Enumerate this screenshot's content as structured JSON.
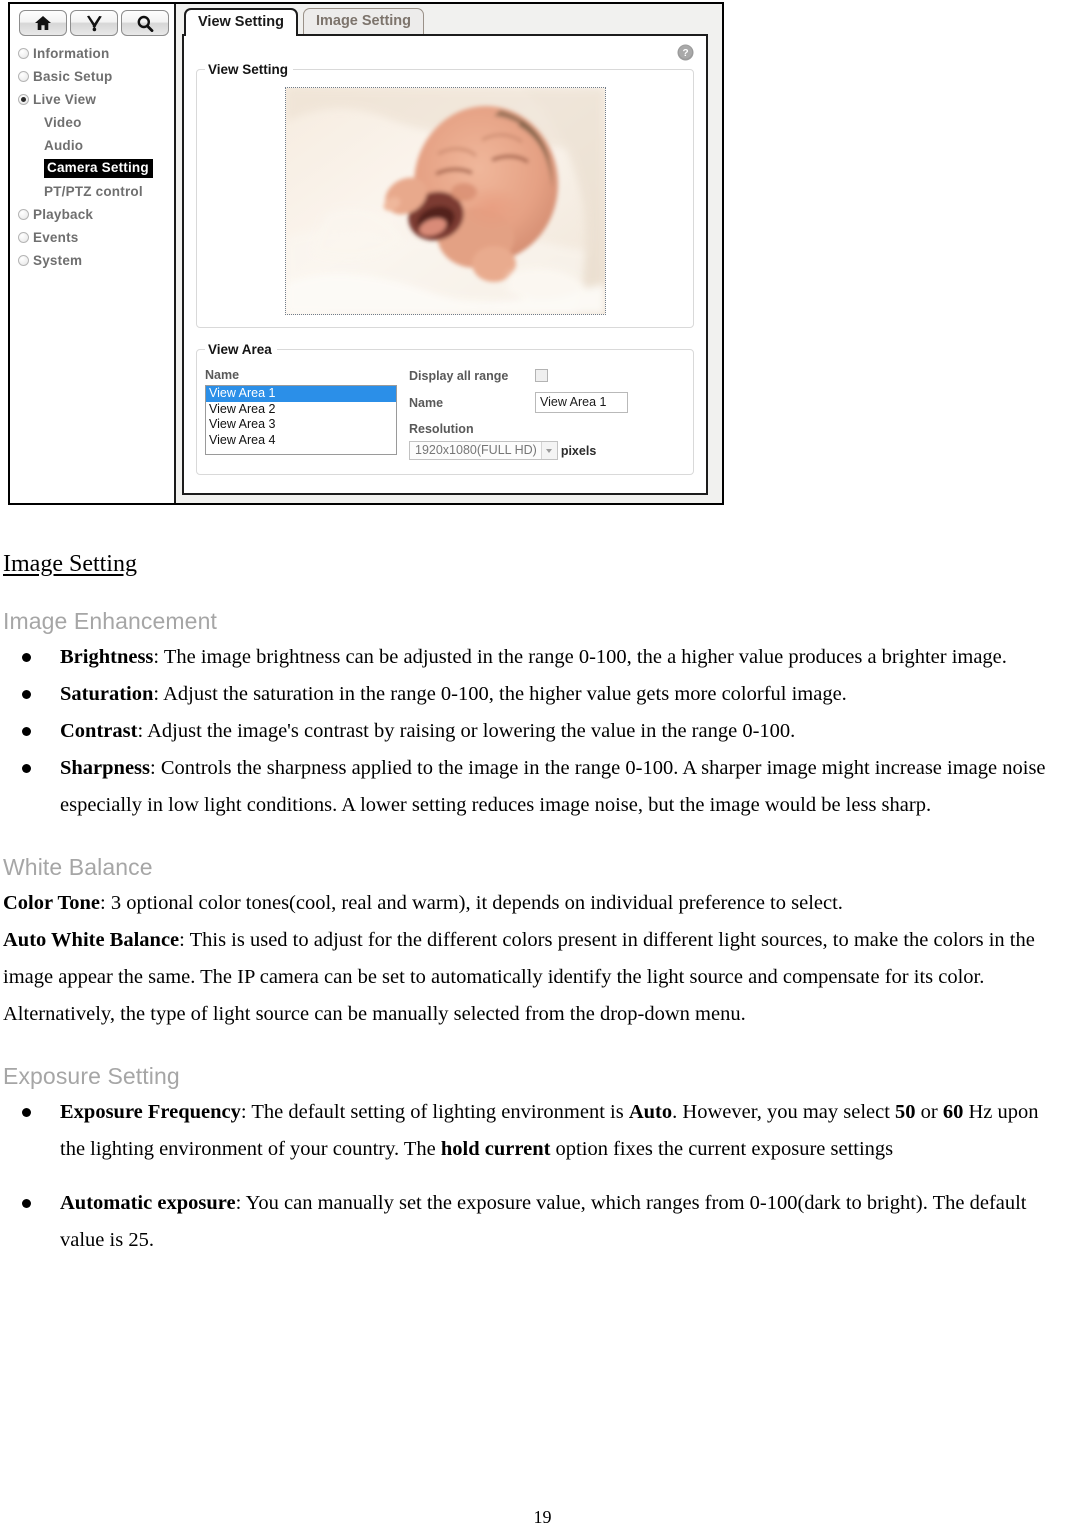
{
  "screenshot": {
    "toolbar": {
      "buttons": [
        {
          "name": "home-button",
          "icon": "home-icon"
        },
        {
          "name": "tools-button",
          "icon": "tools-icon"
        },
        {
          "name": "search-button",
          "icon": "search-icon"
        }
      ]
    },
    "sidebar": {
      "items": [
        {
          "label": "Information",
          "selected": false
        },
        {
          "label": "Basic Setup",
          "selected": false
        },
        {
          "label": "Live View",
          "selected": true
        }
      ],
      "subitems": [
        {
          "label": "Video",
          "selected": false
        },
        {
          "label": "Audio",
          "selected": false
        },
        {
          "label": "Camera Setting",
          "selected": true
        },
        {
          "label": "PT/PTZ control",
          "selected": false
        }
      ],
      "items_after": [
        {
          "label": "Playback",
          "selected": false
        },
        {
          "label": "Events",
          "selected": false
        },
        {
          "label": "System",
          "selected": false
        }
      ]
    },
    "tabs": [
      {
        "label": "View Setting",
        "active": true
      },
      {
        "label": "Image Setting",
        "active": false
      }
    ],
    "help_icon": "help-icon",
    "view_setting": {
      "legend": "View Setting",
      "preview_alt": "live camera preview of a yawning newborn baby on white bedding"
    },
    "view_area": {
      "legend": "View Area",
      "name_list_label": "Name",
      "options": [
        "View Area 1",
        "View Area 2",
        "View Area 3",
        "View Area 4"
      ],
      "selected_option": "View Area 1",
      "display_all_range_label": "Display all range",
      "display_all_range_checked": false,
      "name_label": "Name",
      "name_value": "View Area 1",
      "resolution_label": "Resolution",
      "resolution_value": "1920x1080(FULL HD)",
      "resolution_units": "pixels"
    },
    "colors": {
      "selection_blue": "#2b8fe8",
      "selected_nav_bg": "#000000",
      "nav_text": "#6f6f6f",
      "inactive_tab_text": "#7d746c"
    }
  },
  "document": {
    "section_title": "Image Setting",
    "image_enhancement": {
      "heading": "Image Enhancement",
      "bullets": [
        {
          "term": "Brightness",
          "text": ": The image brightness can be adjusted in the range 0-100, the a higher value produces a brighter image."
        },
        {
          "term": "Saturation",
          "text": ": Adjust the saturation in the range 0-100, the higher value gets more colorful image."
        },
        {
          "term": "Contrast",
          "text": ": Adjust the image's contrast by raising or lowering the value in the range 0-100."
        },
        {
          "term": "Sharpness",
          "text": ": Controls the sharpness applied to the image in the range 0-100. A sharper image might increase image noise especially in low light conditions. A lower setting reduces image noise, but the image would be less sharp."
        }
      ]
    },
    "white_balance": {
      "heading": "White Balance",
      "color_tone_term": "Color Tone",
      "color_tone_text": ": 3 optional color tones(cool, real and warm), it depends on individual preference to select.",
      "auto_wb_term": "Auto White Balance",
      "auto_wb_text": ": This is used to adjust for the different colors present in different light sources, to make the colors in the image appear the same. The IP camera can be set to automatically identify the light source and compensate for its color. Alternatively, the type of light source can be manually selected from the drop-down menu."
    },
    "exposure_setting": {
      "heading": "Exposure Setting",
      "bullet1": {
        "term": "Exposure Frequency",
        "part1": ": The default setting of lighting environment is ",
        "bold1": "Auto",
        "part2": ". However, you may select ",
        "bold2": "50",
        "part3": " or ",
        "bold3": "60",
        "part4": " Hz upon the lighting environment of your country. The ",
        "bold4": "hold current",
        "part5": " option fixes the current exposure settings"
      },
      "bullet2": {
        "term": "Automatic exposure",
        "text": ": You can manually set the exposure value, which ranges from 0-100(dark to bright). The default value is 25."
      }
    },
    "page_number": "19"
  }
}
